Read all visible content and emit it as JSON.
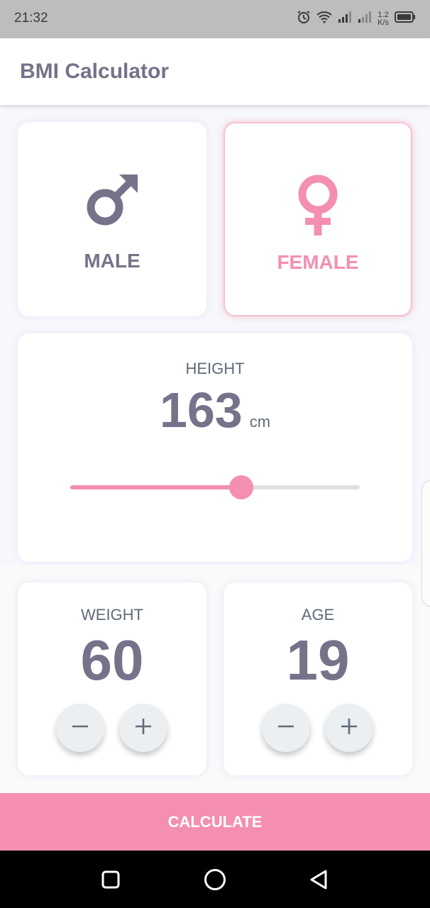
{
  "status_bar": {
    "time": "21:32",
    "speed_value": "1.2",
    "speed_unit": "K/s",
    "icons": [
      "alarm-icon",
      "wifi-icon",
      "signal-icon",
      "signal-icon",
      "battery-icon"
    ]
  },
  "app_bar": {
    "title": "BMI Calculator"
  },
  "gender": {
    "male": {
      "label": "MALE",
      "icon": "male-symbol-icon",
      "color": "#75738a",
      "selected": false
    },
    "female": {
      "label": "FEMALE",
      "icon": "female-symbol-icon",
      "color": "#f48fb1",
      "selected": true
    }
  },
  "height": {
    "label": "HEIGHT",
    "value": "163",
    "unit": "cm",
    "slider_fraction": 0.59
  },
  "weight": {
    "label": "WEIGHT",
    "value": "60",
    "minus_icon": "minus-icon",
    "plus_icon": "plus-icon"
  },
  "age": {
    "label": "AGE",
    "value": "19",
    "minus_icon": "minus-icon",
    "plus_icon": "plus-icon"
  },
  "calculate_button": {
    "label": "CALCULATE"
  },
  "colors": {
    "accent": "#f48fb1",
    "text_primary": "#75738a",
    "text_secondary": "#5f6b78",
    "card_background": "#ffffff"
  },
  "nav_bar": {
    "icons": [
      "recent-apps-icon",
      "home-icon",
      "back-icon"
    ]
  }
}
